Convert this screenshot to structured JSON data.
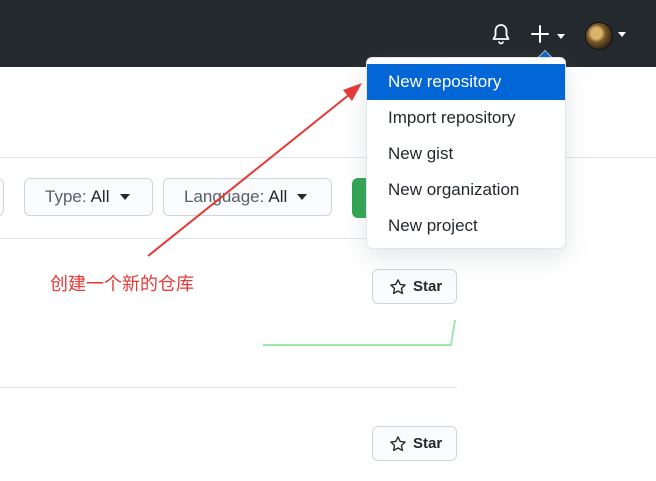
{
  "header": {
    "icons": [
      "bell-icon",
      "plus-icon",
      "avatar"
    ]
  },
  "filters": {
    "type_label": "Type:",
    "type_value": "All",
    "language_label": "Language:",
    "language_value": "All"
  },
  "dropdown": {
    "items": [
      {
        "label": "New repository",
        "active": true
      },
      {
        "label": "Import repository",
        "active": false
      },
      {
        "label": "New gist",
        "active": false
      },
      {
        "label": "New organization",
        "active": false
      },
      {
        "label": "New project",
        "active": false
      }
    ]
  },
  "repos": [
    {
      "star_label": "Star"
    },
    {
      "star_label": "Star"
    }
  ],
  "annotation": {
    "text": "创建一个新的仓库",
    "color": "#e53935"
  },
  "colors": {
    "header_bg": "#24292e",
    "accent": "#0366d6",
    "green": "#2ea44f"
  }
}
